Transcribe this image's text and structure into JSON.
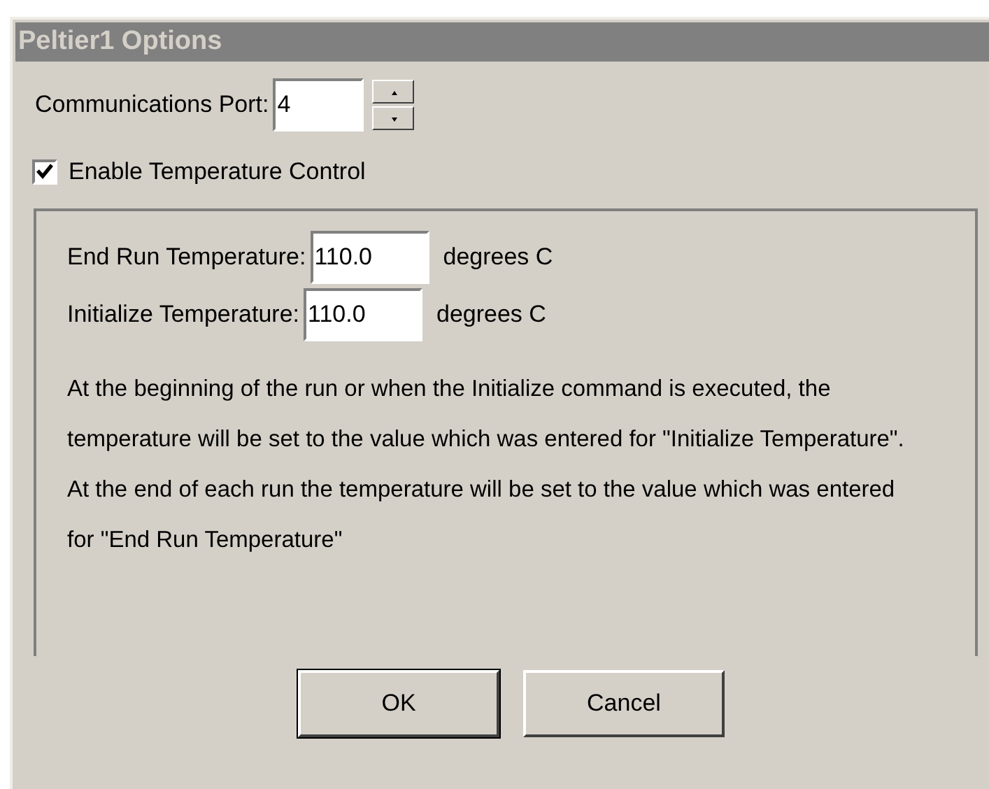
{
  "window": {
    "title": "Peltier1 Options"
  },
  "port": {
    "label": "Communications Port:",
    "value": "4"
  },
  "enable_checkbox": {
    "label": "Enable Temperature Control",
    "checked": true
  },
  "fields": [
    {
      "label": "End Run Temperature:",
      "value": "110.0",
      "unit": "degrees C"
    },
    {
      "label": "Initialize Temperature:",
      "value": "110.0",
      "unit": "degrees C"
    }
  ],
  "description": [
    "At the beginning of the run or when the Initialize command is executed, the temperature will be set to the value which was entered for \"Initialize Temperature\".",
    "At the end of each run the temperature will be set to the value which was entered for \"End Run Temperature\""
  ],
  "buttons": [
    "OK",
    "Cancel"
  ]
}
